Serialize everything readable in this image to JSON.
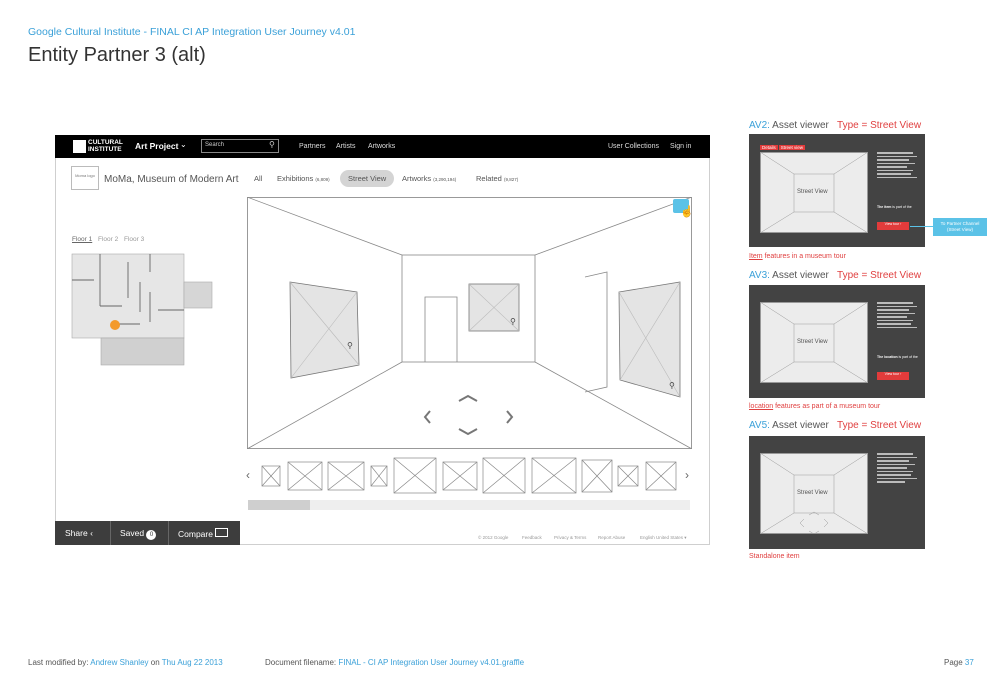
{
  "doc": {
    "header": "Google Cultural Institute  - FINAL CI AP Integration User Journey v4.01",
    "title": "Entity Partner 3 (alt)"
  },
  "topbar": {
    "logo_line1": "CULTURAL",
    "logo_line2": "INSTITUTE",
    "app_name": "Art Project",
    "search_placeholder": "Search",
    "nav": [
      "Partners",
      "Artists",
      "Artworks"
    ],
    "right": [
      "User Collections",
      "Sign in"
    ]
  },
  "partner": {
    "thumb_label": "Moma logo",
    "name": "MoMa, Museum of Modern Art",
    "tabs": [
      {
        "label": "All",
        "count": ""
      },
      {
        "label": "Exhibitions",
        "count": "(6,809)"
      },
      {
        "label": "Street View",
        "count": ""
      },
      {
        "label": "Artworks",
        "count": "(3,290,194)"
      },
      {
        "label": "Related",
        "count": "(9,827)"
      }
    ],
    "active_tab": "Street View"
  },
  "floorplan": {
    "floors": [
      "Floor 1",
      "Floor 2",
      "Floor 3"
    ],
    "active_floor": "Floor 1",
    "marker_color": "#f39a2b"
  },
  "share_bar": {
    "share": "Share",
    "saved": "Saved",
    "saved_count": "0",
    "compare": "Compare"
  },
  "footer": [
    "© 2012 Google",
    "Feedback",
    "Privacy & Terms",
    "Report Abuse",
    "English United States"
  ],
  "asset_viewers": [
    {
      "id": "AV2:",
      "label": "Asset viewer",
      "type": "Type = Street View",
      "inner_label": "Street View",
      "tab_left": "Details",
      "tab_right": "Street view",
      "caption_link": "Item",
      "caption_rest": "features in a museum tour",
      "side_strong": "The item",
      "side_rest": "is part of the",
      "button": "View tour ›"
    },
    {
      "id": "AV3:",
      "label": "Asset viewer",
      "type": "Type = Street View",
      "inner_label": "Street View",
      "caption_link": "location",
      "caption_rest": "features as part of a museum tour",
      "side_strong": "The location",
      "side_rest": "is part of the",
      "button": "View tour ›"
    },
    {
      "id": "AV5:",
      "label": "Asset viewer",
      "type": "Type = Street View",
      "inner_label": "Street View",
      "caption_link": "",
      "caption_rest": "Standalone item"
    }
  ],
  "callout": {
    "line1": "To Partner Channel",
    "line2": "(Street View)"
  },
  "doc_footer": {
    "modified_prefix": "Last modified by:",
    "author": "Andrew Shanley",
    "on": "on",
    "date": "Thu Aug 22 2013",
    "file_prefix": "Document filename:",
    "filename": "FINAL - CI AP Integration User Journey v4.01.graffle",
    "page_prefix": "Page",
    "page": "37"
  },
  "colors": {
    "accent": "#3aa0d8",
    "type_red": "#e04040",
    "panel_dark": "#434343"
  }
}
